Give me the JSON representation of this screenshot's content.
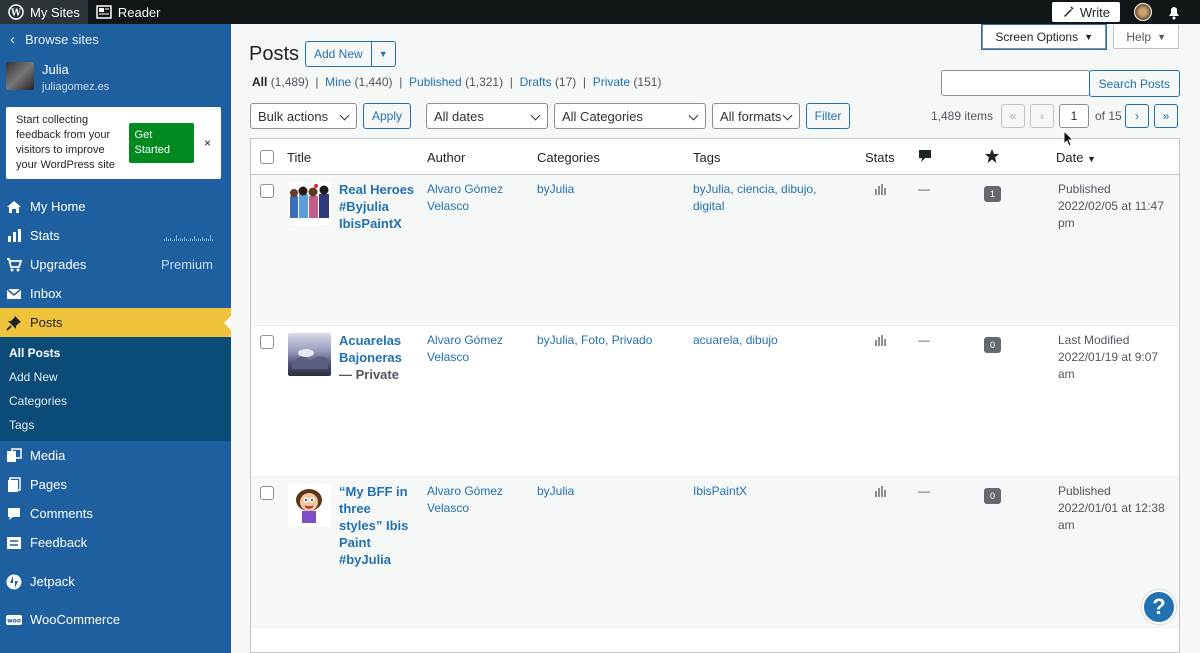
{
  "topbar": {
    "my_sites": "My Sites",
    "reader": "Reader",
    "write": "Write"
  },
  "sidebar": {
    "browse": "Browse sites",
    "user_name": "Julia",
    "site_url": "juliagomez.es",
    "promo": {
      "text": "Start collecting feedback from your visitors to improve your WordPress site",
      "button": "Get Started",
      "close": "×"
    },
    "menu": [
      {
        "label": "My Home",
        "icon": "home-icon"
      },
      {
        "label": "Stats",
        "icon": "stats-icon"
      },
      {
        "label": "Upgrades",
        "icon": "cart-icon",
        "extra": "Premium"
      },
      {
        "label": "Inbox",
        "icon": "mail-icon"
      },
      {
        "label": "Posts",
        "icon": "pin-icon"
      }
    ],
    "posts_sub": [
      "All Posts",
      "Add New",
      "Categories",
      "Tags"
    ],
    "menu2": [
      {
        "label": "Media",
        "icon": "media-icon"
      },
      {
        "label": "Pages",
        "icon": "pages-icon"
      },
      {
        "label": "Comments",
        "icon": "comments-icon"
      },
      {
        "label": "Feedback",
        "icon": "feedback-icon"
      },
      {
        "label": "Jetpack",
        "icon": "jetpack-icon"
      },
      {
        "label": "WooCommerce",
        "icon": "woo-icon"
      }
    ]
  },
  "header": {
    "screen_options": "Screen Options",
    "help": "Help",
    "title": "Posts",
    "add_new": "Add New"
  },
  "filters": {
    "all": "All",
    "all_count": "(1,489)",
    "mine": "Mine",
    "mine_count": "(1,440)",
    "published": "Published",
    "published_count": "(1,321)",
    "drafts": "Drafts",
    "drafts_count": "(17)",
    "private": "Private",
    "private_count": "(151)"
  },
  "search": {
    "button": "Search Posts",
    "value": ""
  },
  "tablenav": {
    "bulk": "Bulk actions",
    "apply": "Apply",
    "dates": "All dates",
    "categories": "All Categories",
    "formats": "All formats",
    "filter": "Filter",
    "items": "1,489 items",
    "first": "«",
    "prev": "‹",
    "page": "1",
    "of": "of 15",
    "next": "›",
    "last": "»"
  },
  "columns": {
    "title": "Title",
    "author": "Author",
    "categories": "Categories",
    "tags": "Tags",
    "stats": "Stats",
    "date": "Date"
  },
  "rows": [
    {
      "title": "Real Heroes #Byjulia IbisPaintX",
      "state": "",
      "author": "Alvaro Gómez Velasco",
      "categories": "byJulia",
      "tags": "byJulia, ciencia, dibujo, digital",
      "comments": "—",
      "likes": "1",
      "date": "Published 2022/02/05 at 11:47 pm"
    },
    {
      "title": "Acuarelas Bajoneras",
      "state": "— Private",
      "author": "Alvaro Gómez Velasco",
      "categories": "byJulia, Foto, Privado",
      "tags": "acuarela, dibujo",
      "comments": "—",
      "likes": "0",
      "date": "Last Modified 2022/01/19 at 9:07 am"
    },
    {
      "title": "“My BFF in three styles” Ibis Paint #byJulia",
      "state": "",
      "author": "Alvaro Gómez Velasco",
      "categories": "byJulia",
      "tags": "IbisPaintX",
      "comments": "—",
      "likes": "0",
      "date": "Published 2022/01/01 at 12:38 am"
    }
  ],
  "fab": "?"
}
